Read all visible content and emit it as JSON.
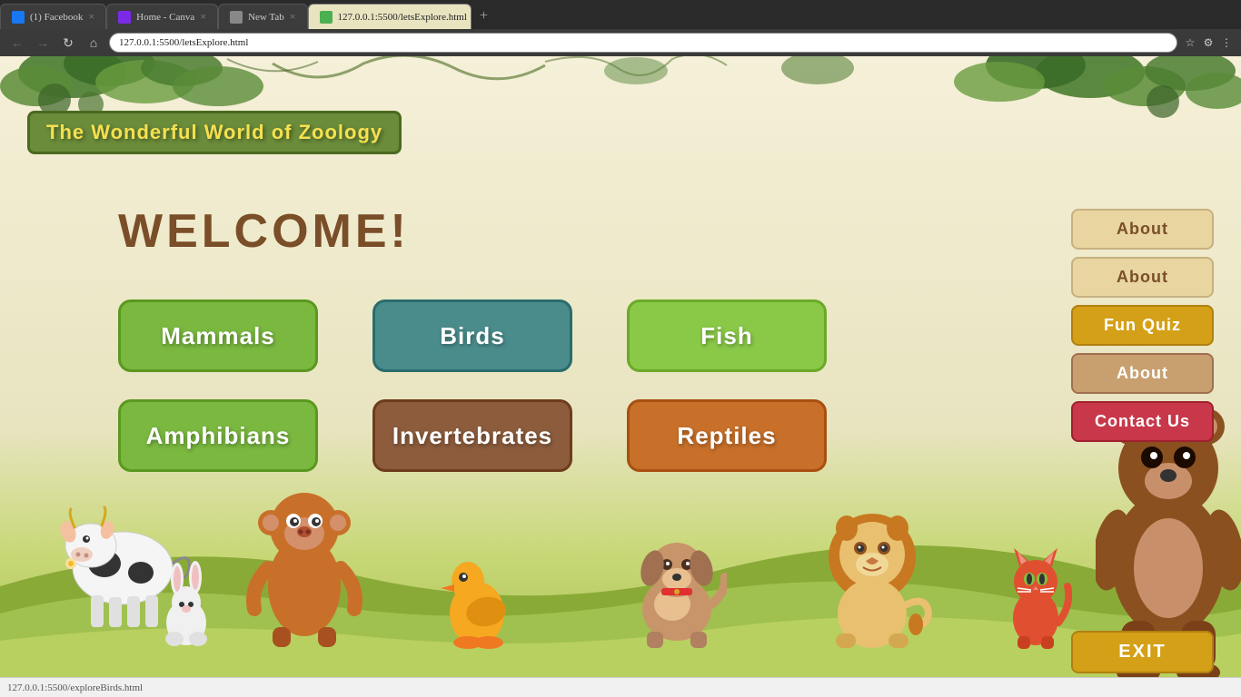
{
  "browser": {
    "tabs": [
      {
        "label": "(1) Facebook",
        "favicon_color": "#1877f2",
        "active": false,
        "close": "×"
      },
      {
        "label": "Home - Canva",
        "favicon_color": "#7d2ae8",
        "active": false,
        "close": "×"
      },
      {
        "label": "New Tab",
        "favicon_color": "#888",
        "active": false,
        "close": "×"
      },
      {
        "label": "127.0.0.1:5500/letsExplore.html",
        "favicon_color": "#4CAF50",
        "active": true,
        "close": "×"
      }
    ],
    "new_tab_btn": "+",
    "back_btn": "←",
    "forward_btn": "→",
    "reload_btn": "↻",
    "home_btn": "⌂",
    "address": "127.0.0.1:5500/letsExplore.html"
  },
  "page": {
    "site_title": "The Wonderful World of Zoology",
    "welcome": "WELCOME!",
    "nav": {
      "about1": "About",
      "about2": "About",
      "fun_quiz": "Fun Quiz",
      "about3": "About",
      "contact": "Contact Us",
      "exit": "EXIT"
    },
    "categories": [
      {
        "label": "Mammals",
        "style": "mammals"
      },
      {
        "label": "Birds",
        "style": "birds"
      },
      {
        "label": "Fish",
        "style": "fish"
      },
      {
        "label": "Amphibians",
        "style": "amphibians"
      },
      {
        "label": "Invertebrates",
        "style": "invertebrates"
      },
      {
        "label": "Reptiles",
        "style": "reptiles"
      }
    ]
  },
  "statusbar": {
    "text": "127.0.0.1:5500/exploreBirds.html"
  }
}
